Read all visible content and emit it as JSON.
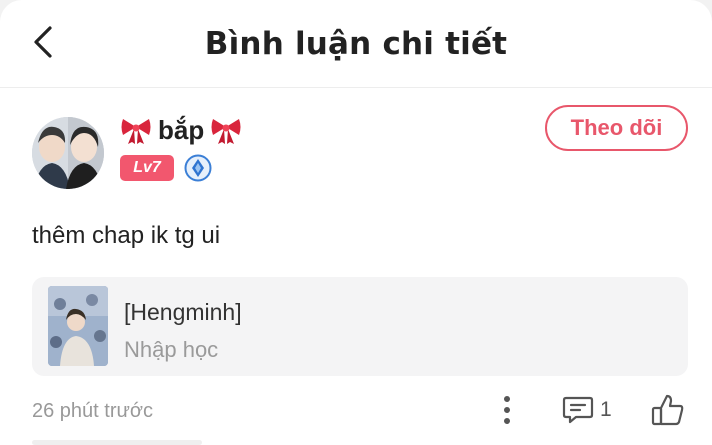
{
  "header": {
    "title": "Bình luận chi tiết",
    "back_icon": "chevron-left-icon"
  },
  "user": {
    "name": "bắp",
    "name_decoration_icon": "red-ribbon-bow-icon",
    "level": "Lv7",
    "level_badge_color": "#f2576e",
    "vip_icon": "blue-diamond-badge-icon",
    "follow_label": "Theo dõi",
    "accent_color": "#e8576b"
  },
  "comment": {
    "text": "thêm chap ik tg ui"
  },
  "story": {
    "title": "[Hengminh]",
    "subtitle": "Nhập học"
  },
  "footer": {
    "timestamp": "26 phút trước",
    "more_icon": "more-vertical-icon",
    "reply_icon": "comment-icon",
    "reply_count": "1",
    "like_icon": "thumbs-up-icon"
  }
}
